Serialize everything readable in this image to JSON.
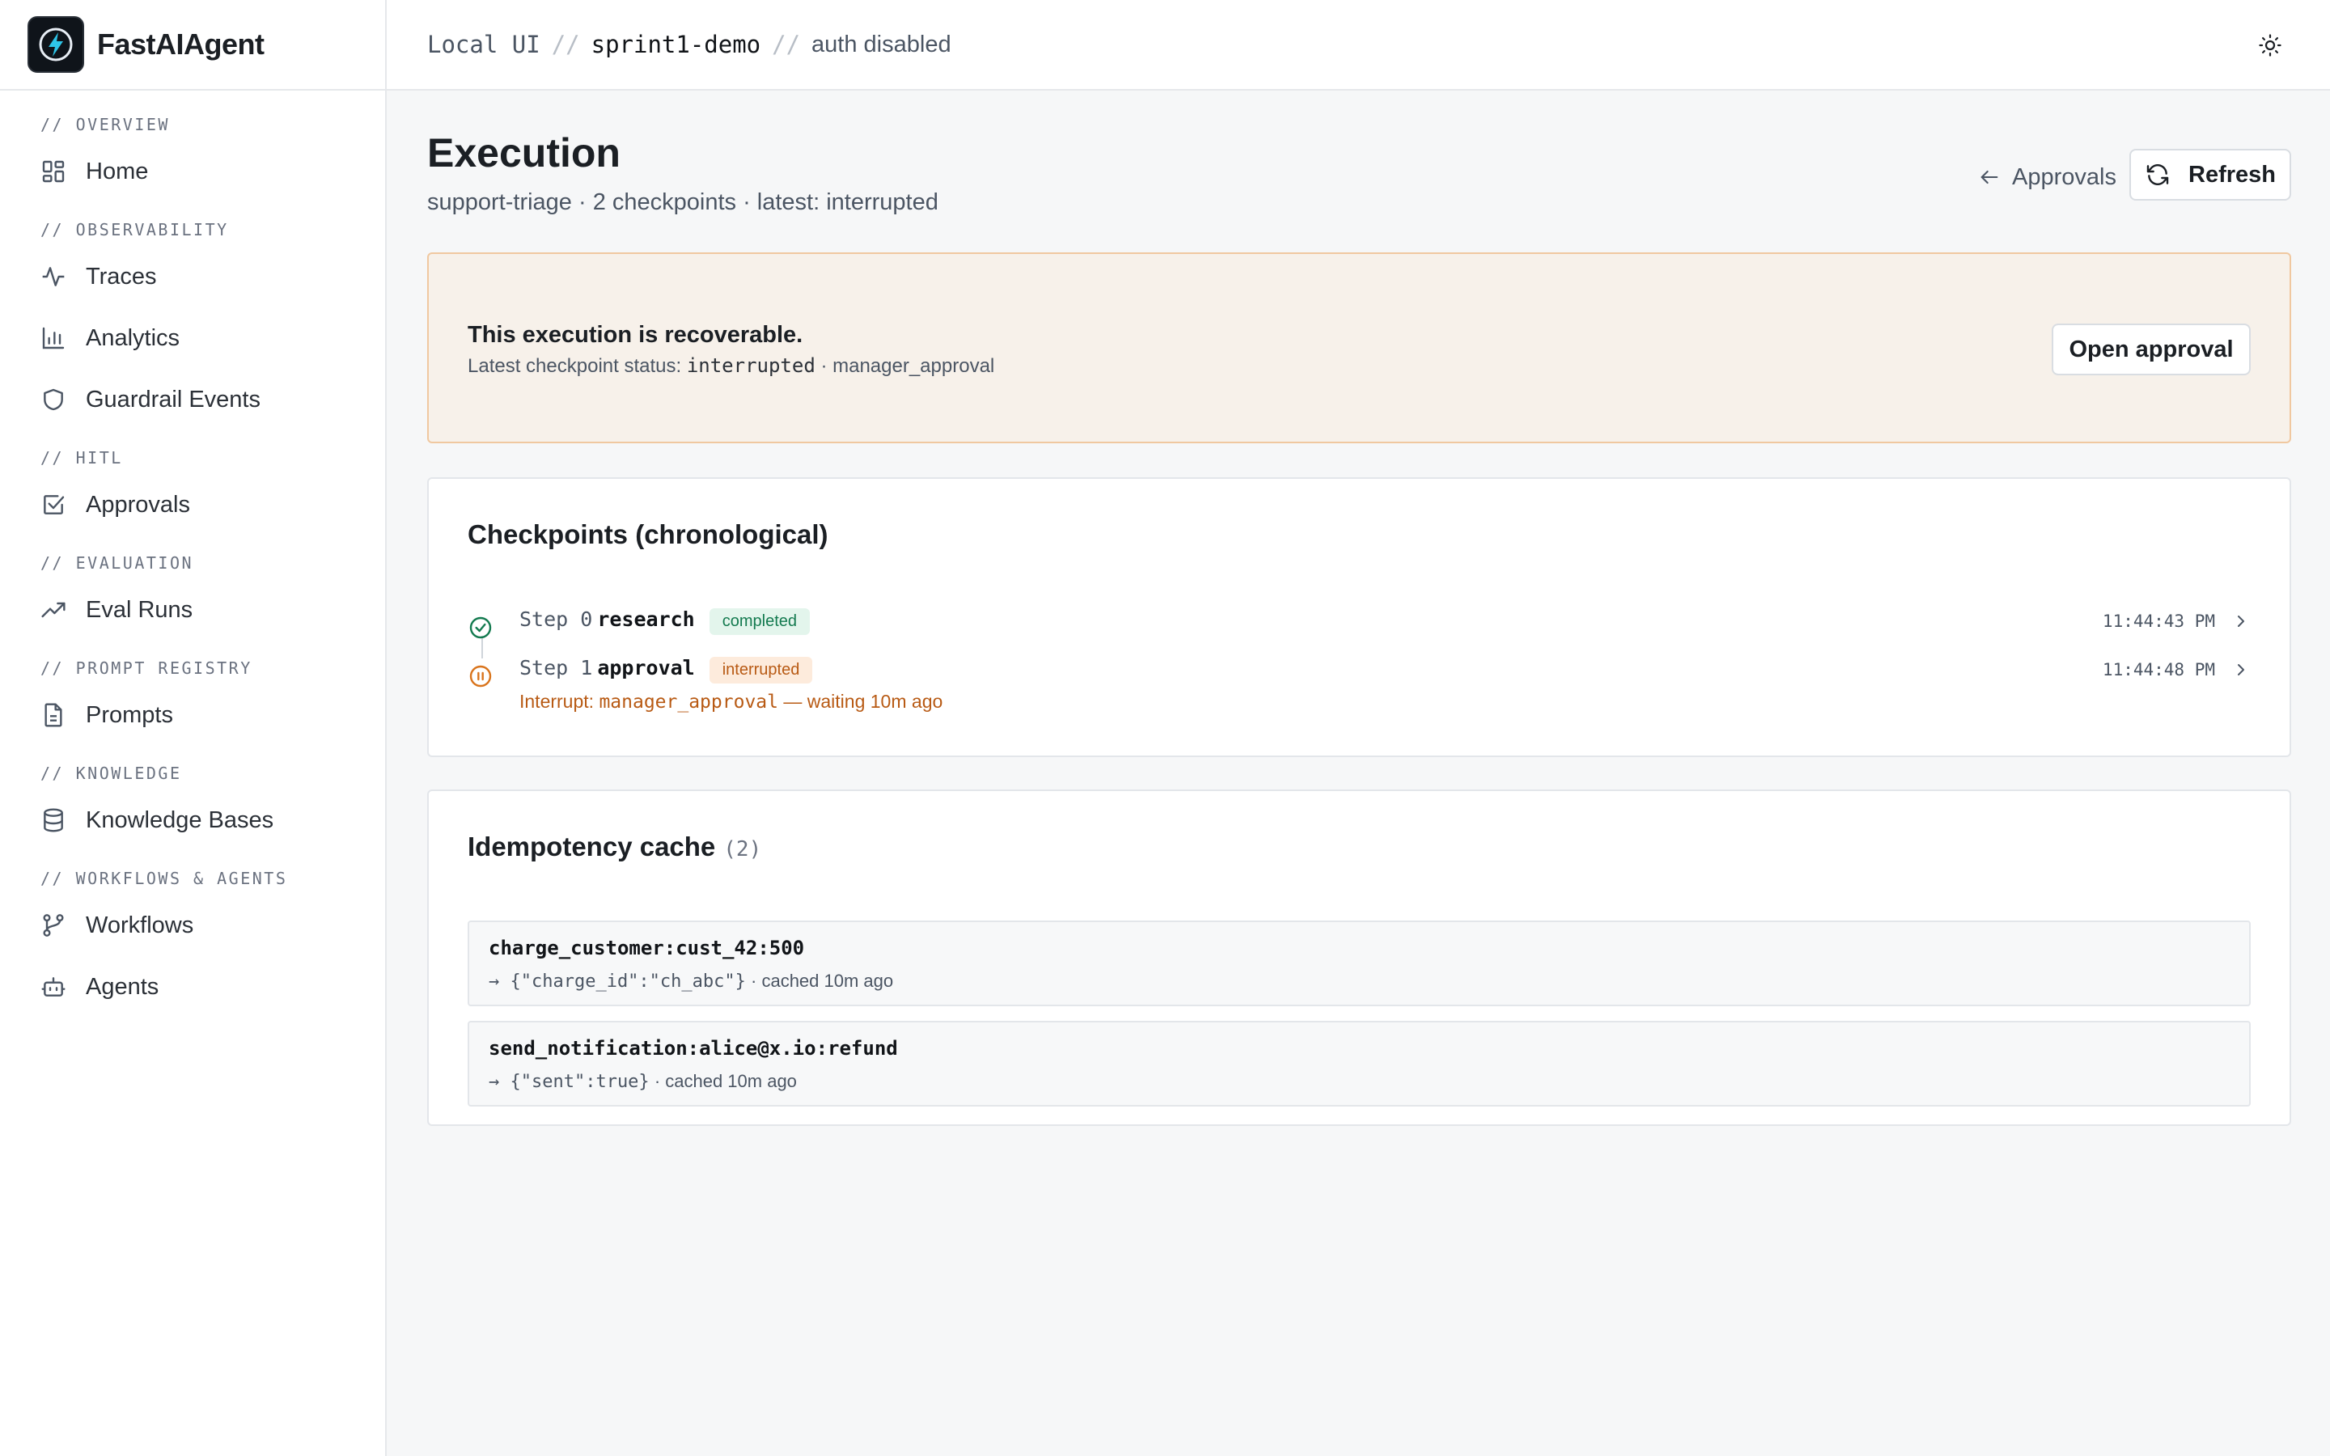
{
  "app": {
    "name": "FastAIAgent"
  },
  "breadcrumb": {
    "local": "Local UI",
    "project": "sprint1-demo",
    "auth": "auth disabled",
    "sep": "//"
  },
  "sidebar": {
    "sections": [
      {
        "heading": "// OVERVIEW",
        "items": [
          {
            "label": "Home"
          }
        ]
      },
      {
        "heading": "// OBSERVABILITY",
        "items": [
          {
            "label": "Traces"
          },
          {
            "label": "Analytics"
          },
          {
            "label": "Guardrail Events"
          }
        ]
      },
      {
        "heading": "// HITL",
        "items": [
          {
            "label": "Approvals"
          }
        ]
      },
      {
        "heading": "// EVALUATION",
        "items": [
          {
            "label": "Eval Runs"
          }
        ]
      },
      {
        "heading": "// PROMPT REGISTRY",
        "items": [
          {
            "label": "Prompts"
          }
        ]
      },
      {
        "heading": "// KNOWLEDGE",
        "items": [
          {
            "label": "Knowledge Bases"
          }
        ]
      },
      {
        "heading": "// WORKFLOWS & AGENTS",
        "items": [
          {
            "label": "Workflows"
          },
          {
            "label": "Agents"
          }
        ]
      }
    ]
  },
  "page": {
    "title": "Execution",
    "subtitle": "support-triage · 2 checkpoints · latest: interrupted",
    "back_label": "Approvals",
    "refresh_label": "Refresh"
  },
  "alert": {
    "title": "This execution is recoverable.",
    "detail_prefix": "Latest checkpoint status:",
    "status": "interrupted",
    "detail_suffix": "· manager_approval",
    "button": "Open approval"
  },
  "checkpoints": {
    "title": "Checkpoints (chronological)",
    "items": [
      {
        "step": "Step 0",
        "name": "research",
        "status": "completed",
        "time": "11:44:43 PM"
      },
      {
        "step": "Step 1",
        "name": "approval",
        "status": "interrupted",
        "time": "11:44:48 PM",
        "interrupt_prefix": "Interrupt:",
        "interrupt_key": "manager_approval",
        "interrupt_suffix": "— waiting 10m ago"
      }
    ]
  },
  "cache": {
    "title": "Idempotency cache",
    "count": "(2)",
    "items": [
      {
        "key": "charge_customer:cust_42:500",
        "value": "→ {\"charge_id\":\"ch_abc\"}",
        "meta": "· cached 10m ago"
      },
      {
        "key": "send_notification:alice@x.io:refund",
        "value": "→ {\"sent\":true}",
        "meta": "· cached 10m ago"
      }
    ]
  },
  "colors": {
    "accent_ok": "#137a4f",
    "accent_warn": "#b85a14",
    "alert_bg": "#f7f1ea",
    "alert_border": "#f0c8a0"
  }
}
